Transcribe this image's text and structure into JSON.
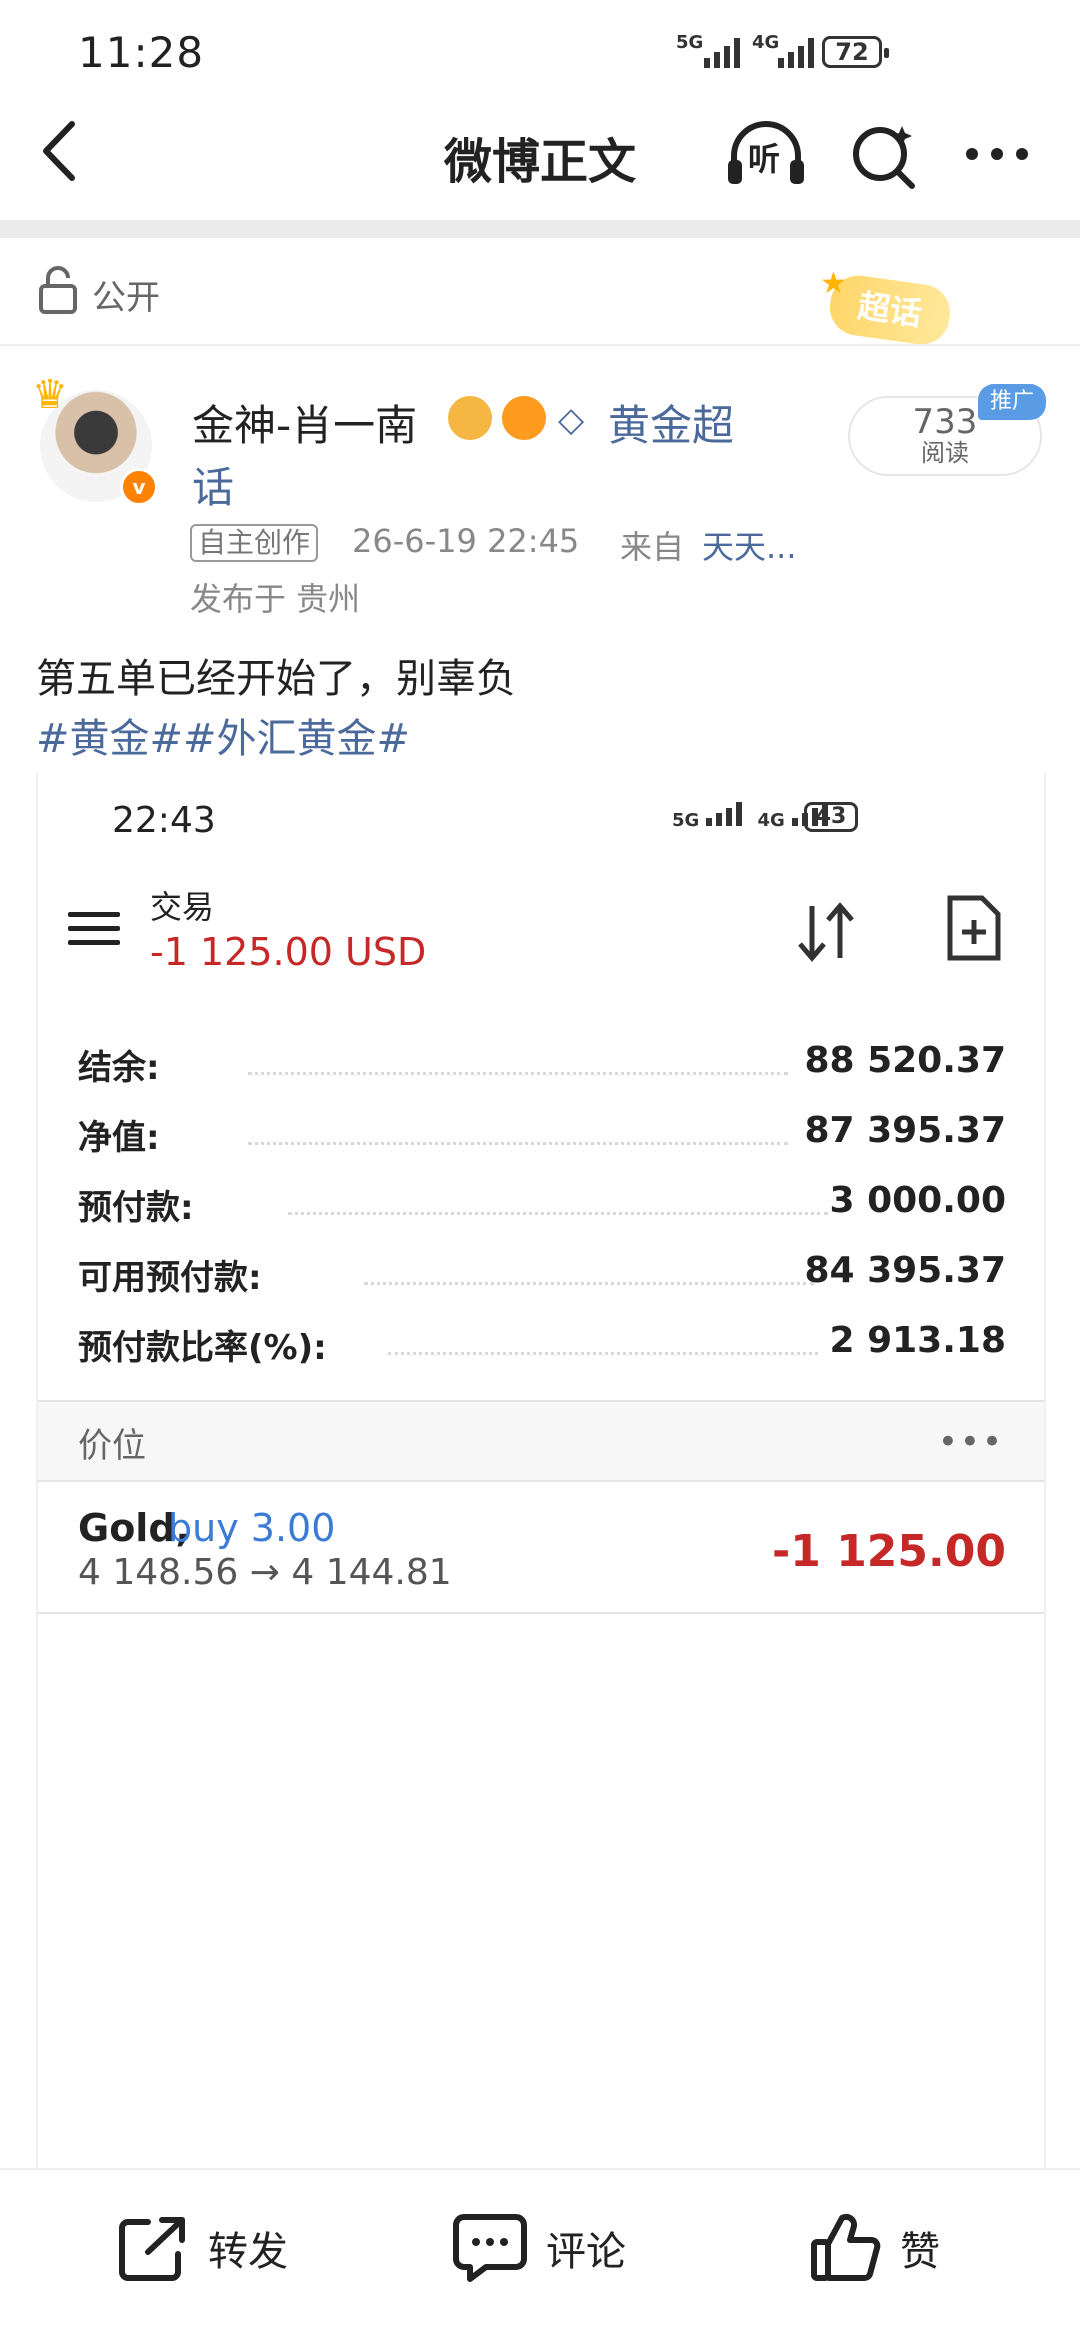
{
  "status_bar": {
    "time": "11:28",
    "net1": "5G",
    "net2": "4G",
    "battery": "72"
  },
  "header": {
    "title": "微博正文",
    "listen_label": "听"
  },
  "visibility": {
    "label": "公开"
  },
  "supertopic_badge": "超话",
  "post": {
    "username": "金神-肖一南",
    "topic_link_1": "黄金超",
    "topic_link_2": "话",
    "read_count": "733",
    "read_label": "阅读",
    "ad_tag": "推广",
    "meta_tag": "自主创作",
    "timestamp": "26-6-19 22:45",
    "from_label": "来自",
    "source": "天天...",
    "location": "发布于 贵州",
    "text": "第五单已经开始了，别辜负",
    "tags": "#黄金##外汇黄金#"
  },
  "screenshot": {
    "time": "22:43",
    "battery": "43",
    "trade_label": "交易",
    "trade_value": "-1 125.00 USD",
    "rows": [
      {
        "label": "结余:",
        "value": "88 520.37"
      },
      {
        "label": "净值:",
        "value": "87 395.37"
      },
      {
        "label": "预付款:",
        "value": "3 000.00"
      },
      {
        "label": "可用预付款:",
        "value": "84 395.37"
      },
      {
        "label": "预付款比率(%):",
        "value": "2 913.18"
      }
    ],
    "price_section": "价位",
    "position": {
      "symbol": "Gold,",
      "side": "buy 3.00",
      "prices": "4 148.56 → 4 144.81",
      "pl": "-1 125.00"
    }
  },
  "bottom_bar": {
    "repost": "转发",
    "comment": "评论",
    "like": "赞"
  }
}
